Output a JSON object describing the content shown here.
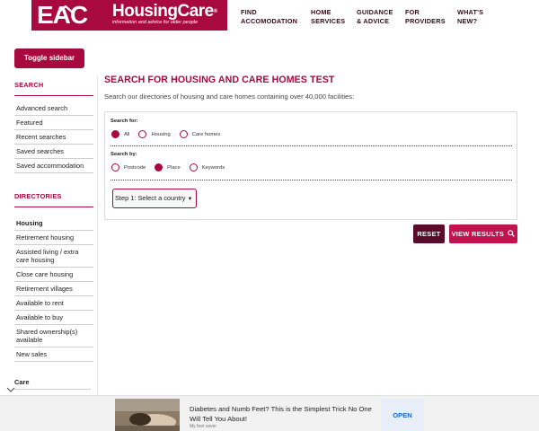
{
  "header": {
    "logo": {
      "mark": "EAC",
      "title": "HousingCare",
      "sup": "®",
      "tagline": "information and advice for older people"
    },
    "nav": [
      {
        "label": "FIND\nACCOMODATION"
      },
      {
        "label": "HOME\nSERVICES"
      },
      {
        "label": "GUIDANCE\n& ADVICE"
      },
      {
        "label": "FOR\nPROVIDERS"
      },
      {
        "label": "WHAT'S\nNEW?"
      }
    ]
  },
  "toggle_sidebar": "Toggle sidebar",
  "sidebar": {
    "search": {
      "heading": "SEARCH",
      "items": [
        "Advanced search",
        "Featured",
        "Recent searches",
        "Saved searches",
        "Saved accommodation"
      ]
    },
    "directories": {
      "heading": "DIRECTORIES",
      "items": [
        "Housing",
        "Retirement housing",
        "Assisted living / extra care housing",
        "Close care housing",
        "Retirement villages",
        "Available to rent",
        "Available to buy",
        "Shared ownership(s) available",
        "New sales"
      ]
    },
    "care": {
      "label": "Care"
    }
  },
  "main": {
    "title": "SEARCH FOR HOUSING AND CARE HOMES TEST",
    "subtitle": "Search our directories of housing and care homes containing over 40,000 facilities:",
    "search_for": {
      "label": "Search for:",
      "options": [
        "All",
        "Housing",
        "Care homes"
      ],
      "selected": "All"
    },
    "search_by": {
      "label": "Search by:",
      "options": [
        "Postcode",
        "Place",
        "Keywords"
      ],
      "selected": "Place"
    },
    "country_select": {
      "value": "Step 1: Select a country"
    },
    "reset_label": "RESET",
    "view_results_label": "VIEW RESULTS"
  },
  "ad": {
    "title": "Diabetes and Numb Feet? This is the Simplest Trick No One Will Tell You About!",
    "source": "My feet saver",
    "open_label": "OPEN"
  },
  "colors": {
    "brand": "#a8093f",
    "reset": "#5a0b2a",
    "view": "#c1134e",
    "ad_link": "#1a66c9"
  }
}
